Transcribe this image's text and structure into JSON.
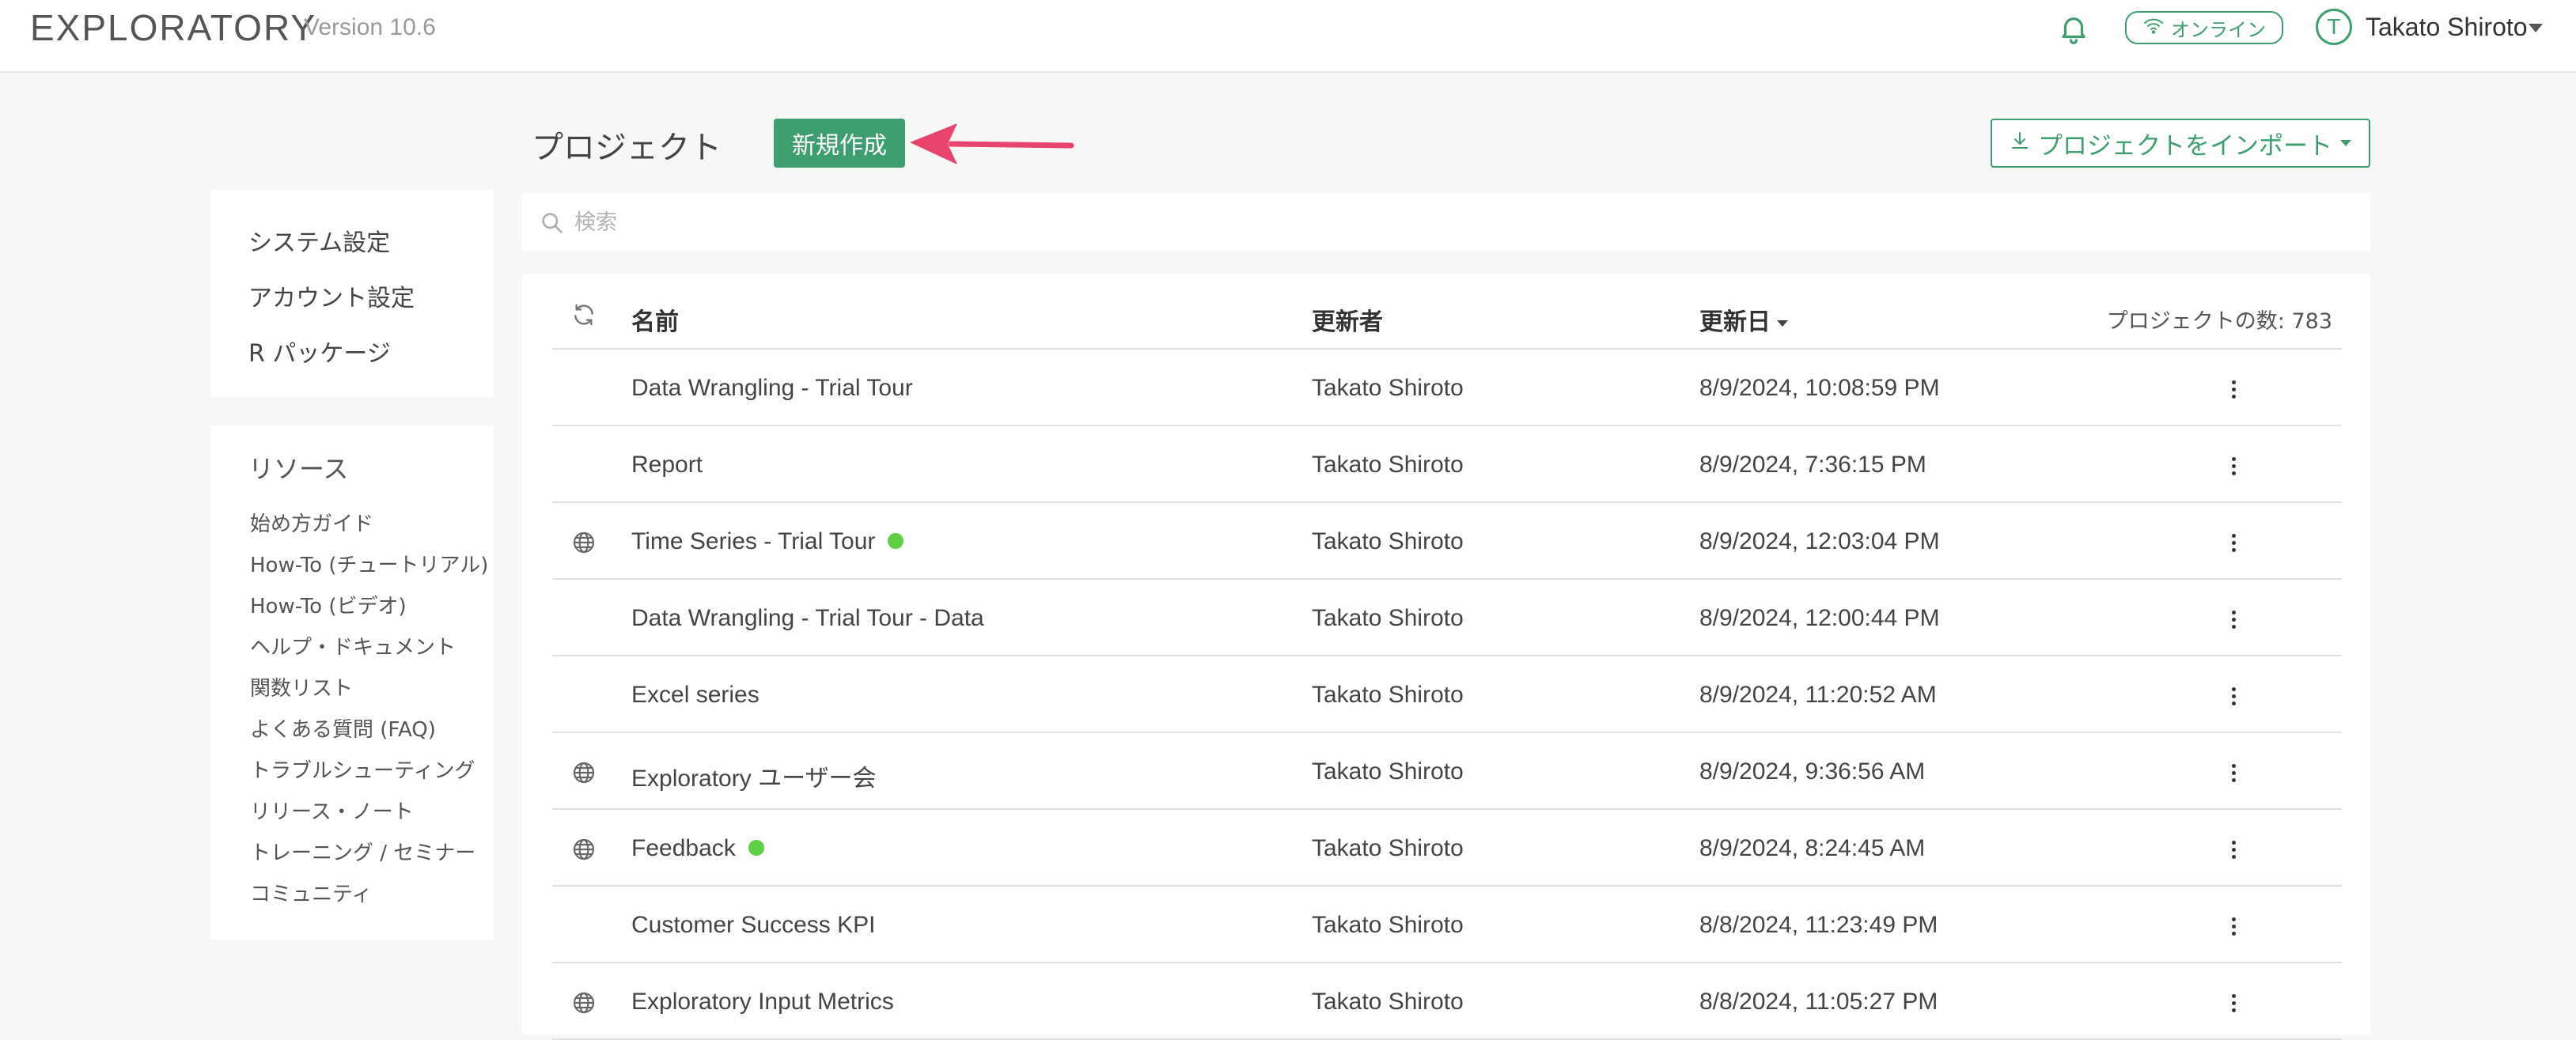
{
  "header": {
    "brand": "EXPLORATORY",
    "version": "Version 10.6",
    "online_label": "オンライン",
    "avatar_initial": "T",
    "user_name": "Takato Shiroto"
  },
  "sidebar": {
    "settings": [
      "システム設定",
      "アカウント設定",
      "R パッケージ"
    ],
    "resources_title": "リソース",
    "resources": [
      "始め方ガイド",
      "How-To (チュートリアル)",
      "How-To (ビデオ)",
      "ヘルプ・ドキュメント",
      "関数リスト",
      "よくある質問 (FAQ)",
      "トラブルシューティング",
      "リリース・ノート",
      "トレーニング / セミナー",
      "コミュニティ"
    ]
  },
  "main": {
    "title": "プロジェクト",
    "new_button": "新規作成",
    "import_button": "プロジェクトをインポート",
    "search_placeholder": "検索",
    "columns": {
      "name": "名前",
      "updater": "更新者",
      "updated": "更新日",
      "count": "プロジェクトの数: 783"
    },
    "rows": [
      {
        "name": "Data Wrangling - Trial Tour",
        "updater": "Takato Shiroto",
        "date": "8/9/2024, 10:08:59 PM",
        "shared": false,
        "active": false
      },
      {
        "name": "Report",
        "updater": "Takato Shiroto",
        "date": "8/9/2024, 7:36:15 PM",
        "shared": false,
        "active": false
      },
      {
        "name": "Time Series - Trial Tour",
        "updater": "Takato Shiroto",
        "date": "8/9/2024, 12:03:04 PM",
        "shared": true,
        "active": true
      },
      {
        "name": "Data Wrangling - Trial Tour - Data",
        "updater": "Takato Shiroto",
        "date": "8/9/2024, 12:00:44 PM",
        "shared": false,
        "active": false
      },
      {
        "name": "Excel series",
        "updater": "Takato Shiroto",
        "date": "8/9/2024, 11:20:52 AM",
        "shared": false,
        "active": false
      },
      {
        "name": "Exploratory ユーザー会",
        "updater": "Takato Shiroto",
        "date": "8/9/2024, 9:36:56 AM",
        "shared": true,
        "active": false
      },
      {
        "name": "Feedback",
        "updater": "Takato Shiroto",
        "date": "8/9/2024, 8:24:45 AM",
        "shared": true,
        "active": true
      },
      {
        "name": "Customer Success KPI",
        "updater": "Takato Shiroto",
        "date": "8/8/2024, 11:23:49 PM",
        "shared": false,
        "active": false
      },
      {
        "name": "Exploratory Input Metrics",
        "updater": "Takato Shiroto",
        "date": "8/8/2024, 11:05:27 PM",
        "shared": true,
        "active": false
      }
    ]
  },
  "colors": {
    "accent": "#3f9e6f",
    "active_dot": "#5fce45",
    "annotation_arrow": "#e8456e"
  }
}
